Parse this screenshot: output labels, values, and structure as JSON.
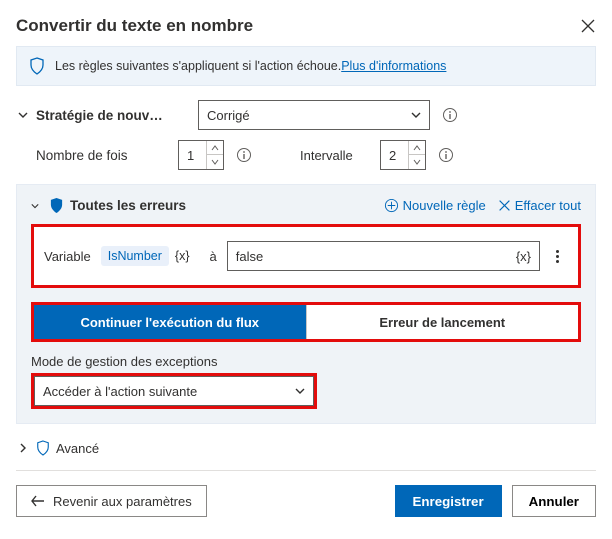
{
  "dialog": {
    "title": "Convertir du texte en nombre"
  },
  "banner": {
    "text": "Les règles suivantes s'appliquent si l'action échoue. ",
    "link": "Plus d'informations"
  },
  "strategy": {
    "label": "Stratégie de nouv…",
    "value": "Corrigé",
    "retries_label": "Nombre de fois",
    "retries_value": "1",
    "interval_label": "Intervalle",
    "interval_value": "2"
  },
  "errors": {
    "title": "Toutes les erreurs",
    "new_rule": "Nouvelle règle",
    "clear_all": "Effacer tout",
    "rule": {
      "var_label": "Variable",
      "var_name": "IsNumber",
      "fx": "{x}",
      "to": "à",
      "value": "false",
      "value_fx": "{x}"
    },
    "tab_continue": "Continuer l'exécution du flux",
    "tab_throw": "Erreur de lancement",
    "mode_label": "Mode de gestion des exceptions",
    "mode_value": "Accéder à l'action suivante"
  },
  "advanced": {
    "label": "Avancé"
  },
  "footer": {
    "back": "Revenir aux paramètres",
    "save": "Enregistrer",
    "cancel": "Annuler"
  }
}
